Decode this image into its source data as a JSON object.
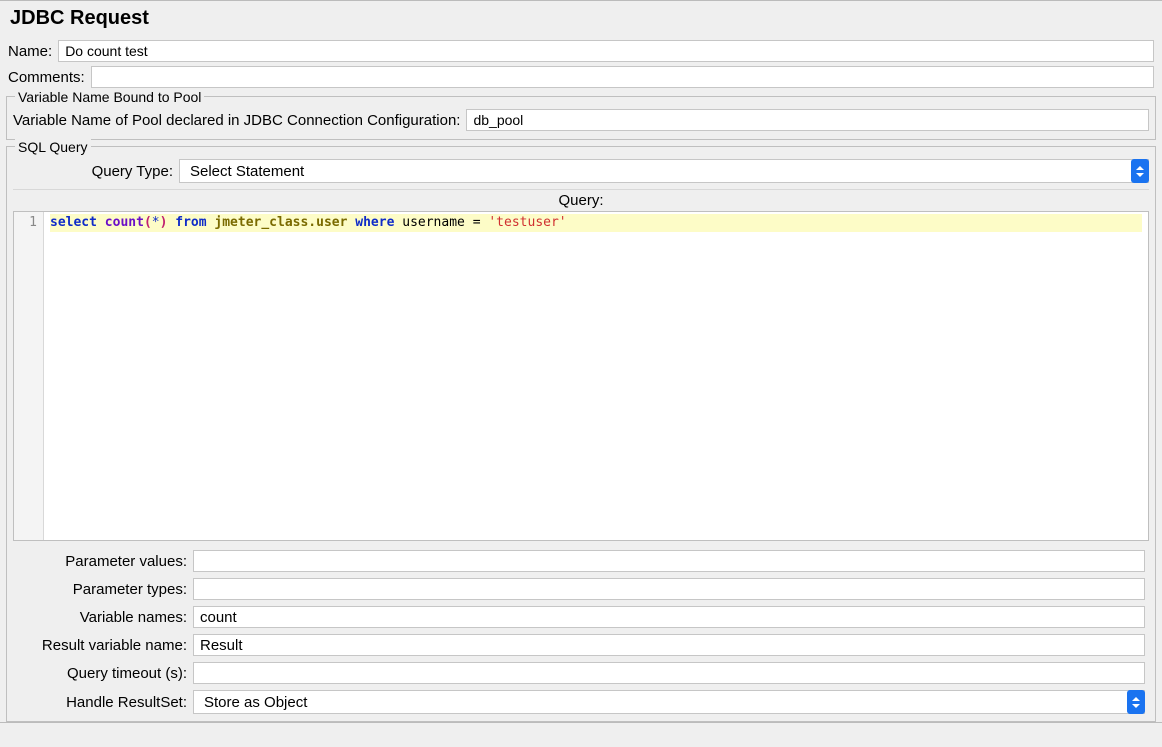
{
  "header": {
    "title": "JDBC Request"
  },
  "fields": {
    "name_label": "Name:",
    "name_value": "Do count test",
    "comments_label": "Comments:",
    "comments_value": ""
  },
  "pool_section": {
    "legend": "Variable Name Bound to Pool",
    "label": "Variable Name of Pool declared in JDBC Connection Configuration:",
    "value": "db_pool"
  },
  "sql_section": {
    "legend": "SQL Query",
    "query_type_label": "Query Type:",
    "query_type_value": "Select Statement",
    "query_label": "Query:",
    "line_number": "1",
    "query_tokens": {
      "select": "select",
      "count": "count",
      "lparen": "(",
      "star": "*",
      "rparen": ")",
      "from": "from",
      "table": "jmeter_class.user",
      "where": "where",
      "column": "username",
      "eq": "=",
      "literal": "'testuser'"
    },
    "parameter_values_label": "Parameter values:",
    "parameter_values_value": "",
    "parameter_types_label": "Parameter types:",
    "parameter_types_value": "",
    "variable_names_label": "Variable names:",
    "variable_names_value": "count",
    "result_variable_name_label": "Result variable name:",
    "result_variable_name_value": "Result",
    "query_timeout_label": "Query timeout (s):",
    "query_timeout_value": "",
    "handle_resultset_label": "Handle ResultSet:",
    "handle_resultset_value": "Store as Object"
  }
}
